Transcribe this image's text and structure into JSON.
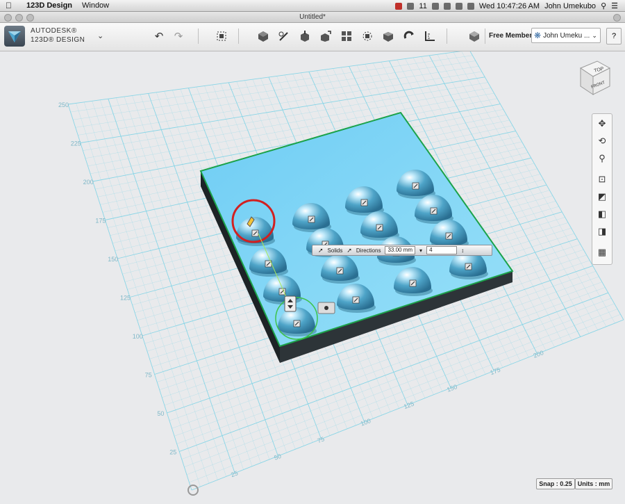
{
  "menubar": {
    "apple": "",
    "app_name": "123D Design",
    "menu_window": "Window",
    "status_number": "11",
    "clock": "Wed 10:47:26 AM",
    "user": "John Umekubo"
  },
  "window": {
    "title": "Untitled*"
  },
  "brand": {
    "line1": "AUTODESK®",
    "line2": "123D® DESIGN",
    "menu_chevron": "⌄"
  },
  "toolbar": {
    "icons": [
      "undo-icon",
      "redo-icon",
      "transform-icon",
      "primitives-icon",
      "sketch-icon",
      "construct-icon",
      "modify-icon",
      "pattern-icon",
      "grouping-icon",
      "combine-icon",
      "snap-icon",
      "measure-icon",
      "text-icon",
      "materials-icon"
    ],
    "undo_glyph": "↶",
    "redo_glyph": "↷",
    "free_member": "Free Member",
    "user_name": "John Umeku ...",
    "help": "?"
  },
  "viewcube": {
    "top": "TOP",
    "front": "FRONT"
  },
  "navbar": {
    "items": [
      "pan-icon",
      "orbit-icon",
      "zoom-icon",
      "fit-icon",
      "perspective-icon",
      "materials-outlines-icon",
      "visibility-icon",
      "grid-icon"
    ],
    "glyphs": [
      "✥",
      "⟲",
      "⚲",
      "⊡",
      "◩",
      "◧",
      "◨",
      "▦"
    ]
  },
  "grid_axis_labels": {
    "left": [
      "250",
      "225",
      "200",
      "175",
      "150",
      "125",
      "100",
      "75",
      "50",
      "25"
    ],
    "bottom": [
      "25",
      "50",
      "75",
      "100",
      "125",
      "150",
      "175",
      "200"
    ]
  },
  "floating_toolbar": {
    "solid_label": "Solids",
    "direction_label": "Directions",
    "distance_value": "33.00 mm",
    "count_value": "4"
  },
  "status": {
    "snap": "Snap : 0.25",
    "units": "Units : mm"
  },
  "colors": {
    "grid_line": "#7fd3e6",
    "plate_top": "#7fd4f5",
    "plate_side": "#2a2f33",
    "plate_edge": "#1ca24a",
    "hemisphere": "#5bb8d8",
    "selection_ring": "#d22020"
  }
}
